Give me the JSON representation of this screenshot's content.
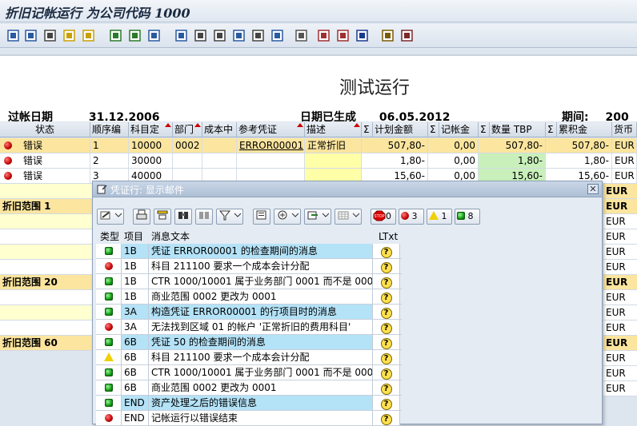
{
  "window": {
    "title": "折旧记帐运行 为公司代码 1000"
  },
  "toolbar": {
    "icons": [
      "details-icon",
      "find-icon",
      "print-icon",
      "filter-icon",
      "set-filter-icon",
      "sum-icon",
      "subtotal-icon",
      "display-icon",
      "export-icon",
      "print-preview-icon",
      "mail-icon",
      "graphic-icon",
      "layout-icon",
      "word-icon",
      "excel-icon",
      "abc-icon",
      "grid-icon",
      "move-icon",
      "insert-icon",
      "info-icon",
      "edit-icon",
      "settings-icon"
    ]
  },
  "report": {
    "title": "测试运行",
    "header_cut_left": "过帐日期",
    "header_cut_left_value": "31.12.2006",
    "header_cut_mid": "日期已生成",
    "header_cut_mid_value": "06.05.2012",
    "header_cut_right": "期间:",
    "header_cut_right_value": "200"
  },
  "grid": {
    "columns": [
      "状态",
      "顺序编",
      "科目定",
      "部门",
      "成本中",
      "参考凭证",
      "描述",
      "Σ",
      "计划金额",
      "Σ",
      "记帐金",
      "Σ",
      "数量 TBP",
      "Σ",
      "累积金",
      "货币"
    ],
    "rows": [
      {
        "status": "错误",
        "seq": "1",
        "acct": "10000",
        "dept": "0002",
        "ref": "ERROR00001",
        "desc": "正常折旧",
        "plan": "507,80-",
        "post": "0,00",
        "qty": "507,80-",
        "accum": "507,80-",
        "cur": "EUR",
        "selected": true
      },
      {
        "status": "错误",
        "seq": "2",
        "acct": "30000",
        "dept": "",
        "ref": "",
        "desc": "",
        "plan": "1,80-",
        "post": "0,00",
        "qty": "1,80-",
        "accum": "1,80-",
        "cur": "EUR",
        "selected": false
      },
      {
        "status": "错误",
        "seq": "3",
        "acct": "40000",
        "dept": "",
        "ref": "",
        "desc": "",
        "plan": "15,60-",
        "post": "0,00",
        "qty": "15,60-",
        "accum": "15,60-",
        "cur": "EUR",
        "selected": false
      }
    ],
    "left_rows": [
      {
        "label": "",
        "subtotal": false
      },
      {
        "label": "折旧范围  1",
        "subtotal": true
      },
      {
        "label": "",
        "subtotal": false
      },
      {
        "label": "",
        "subtotal": false
      },
      {
        "label": "",
        "subtotal": false
      },
      {
        "label": "",
        "subtotal": false
      },
      {
        "label": "折旧范围 20",
        "subtotal": true
      },
      {
        "label": "",
        "subtotal": false
      },
      {
        "label": "",
        "subtotal": false
      },
      {
        "label": "",
        "subtotal": false
      },
      {
        "label": "折旧范围 60",
        "subtotal": true
      }
    ],
    "right_cur": [
      "EUR",
      "EUR",
      "EUR",
      "EUR",
      "EUR",
      "EUR",
      "EUR",
      "EUR",
      "EUR",
      "EUR",
      "EUR",
      "EUR",
      "EUR",
      "EUR"
    ]
  },
  "popup": {
    "title": "凭证行: 显示邮件",
    "close": "✕",
    "counts": {
      "stop": "0",
      "error": "3",
      "warning": "1",
      "ok": "8"
    },
    "columns": [
      "类型",
      "项目",
      "消息文本",
      "LTxt"
    ],
    "messages": [
      {
        "type": "ok",
        "item": "1B",
        "text": "凭证 ERROR00001 的检查期间的消息",
        "highlight": true
      },
      {
        "type": "error",
        "item": "1B",
        "text": "科目 211100 要求一个成本会计分配",
        "highlight": false
      },
      {
        "type": "ok",
        "item": "1B",
        "text": "CTR 1000/10001 属于业务部门 0001 而不是 0002",
        "highlight": false
      },
      {
        "type": "ok",
        "item": "1B",
        "text": "商业范围 0002 更改为 0001",
        "highlight": false
      },
      {
        "type": "ok",
        "item": "3A",
        "text": "构造凭证 ERROR00001 的行项目时的消息",
        "highlight": true
      },
      {
        "type": "error",
        "item": "3A",
        "text": "无法找到区域 01 的帐户 '正常折旧的费用科目'",
        "highlight": false
      },
      {
        "type": "ok",
        "item": "6B",
        "text": "凭证 50 的检查期间的消息",
        "highlight": true
      },
      {
        "type": "warning",
        "item": "6B",
        "text": "科目 211100 要求一个成本会计分配",
        "highlight": false
      },
      {
        "type": "ok",
        "item": "6B",
        "text": "CTR 1000/10001 属于业务部门 0001 而不是 0002",
        "highlight": false
      },
      {
        "type": "ok",
        "item": "6B",
        "text": "商业范围 0002 更改为 0001",
        "highlight": false
      },
      {
        "type": "ok",
        "item": "END",
        "text": "资产处理之后的错误信息",
        "highlight": true
      },
      {
        "type": "error",
        "item": "END",
        "text": "记帐运行以错误结束",
        "highlight": false
      }
    ]
  }
}
